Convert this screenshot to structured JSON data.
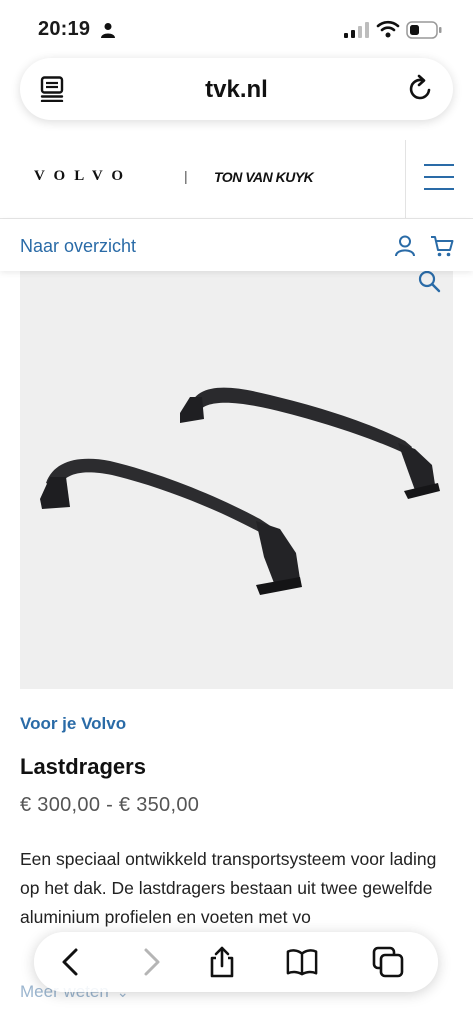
{
  "status_bar": {
    "time": "20:19"
  },
  "browser": {
    "url": "tvk.nl"
  },
  "header": {
    "brand": "VOLVO",
    "separator": "|",
    "dealer": "TON VAN KUYK"
  },
  "subnav": {
    "back_label": "Naar overzicht"
  },
  "product": {
    "category": "Voor je Volvo",
    "title": "Lastdragers",
    "price": "€ 300,00 - € 350,00",
    "description": "Een speciaal ontwikkeld transportsysteem voor lading op het dak. De lastdragers bestaan uit twee gewelfde aluminium profielen en voeten met vo",
    "read_more": "Meer weten"
  },
  "colors": {
    "accent": "#2a6ba7",
    "image_bg": "#efefef"
  },
  "icons": [
    "person-icon",
    "signal-icon",
    "wifi-icon",
    "battery-icon",
    "reader-icon",
    "reload-icon",
    "menu-icon",
    "account-icon",
    "cart-icon",
    "zoom-icon",
    "back-arrow-icon",
    "forward-arrow-icon",
    "share-icon",
    "bookmarks-icon",
    "tabs-icon"
  ]
}
